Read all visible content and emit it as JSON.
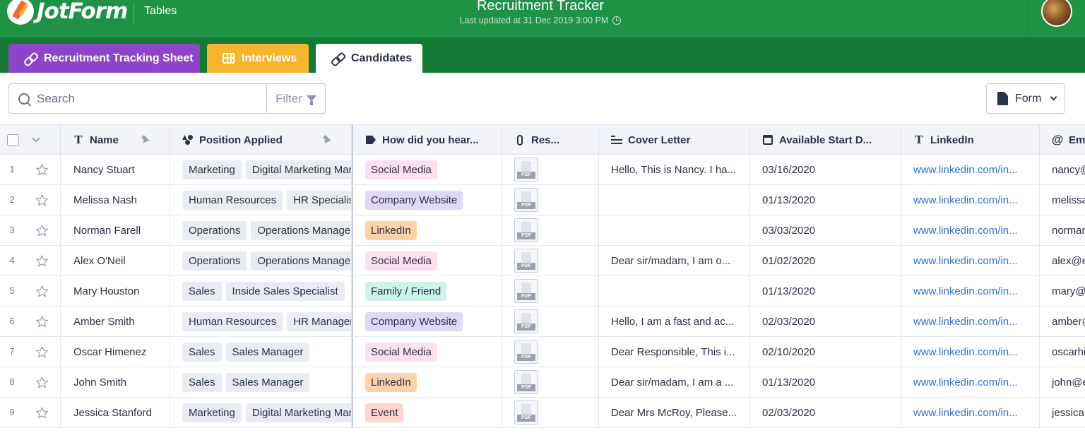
{
  "header": {
    "logo_text": "JotForm",
    "app_name": "Tables",
    "title": "Recruitment Tracker",
    "updated": "Last updated at 31 Dec 2019 3:00 PM",
    "color": "#1e9346"
  },
  "tabs": [
    {
      "label": "Recruitment Tracking Sheet",
      "icon": "link-icon",
      "color": "#8e44c9"
    },
    {
      "label": "Interviews",
      "icon": "grid-icon",
      "color": "#f7b52c"
    },
    {
      "label": "Candidates",
      "icon": "link-icon",
      "color": "#ffffff",
      "active": true
    }
  ],
  "toolbar": {
    "search_placeholder": "Search",
    "filter_label": "Filter",
    "form_label": "Form"
  },
  "columns": {
    "name": "Name",
    "position": "Position Applied",
    "how": "How did you hear...",
    "resume": "Res...",
    "cover": "Cover Letter",
    "start": "Available Start D...",
    "linkedin": "LinkedIn",
    "email": "Em"
  },
  "rows": [
    {
      "num": "1",
      "name": "Nancy Stuart",
      "pos": [
        "Marketing",
        "Digital Marketing Manager"
      ],
      "how": "Social Media",
      "resume": "PDF",
      "cover": "Hello, This is Nancy. I ha...",
      "start": "03/16/2020",
      "linkedin": "www.linkedin.com/in...",
      "email": "nancy@"
    },
    {
      "num": "2",
      "name": "Melissa Nash",
      "pos": [
        "Human Resources",
        "HR Specialist"
      ],
      "how": "Company Website",
      "resume": "PDF",
      "cover": "",
      "start": "01/13/2020",
      "linkedin": "www.linkedin.com/in...",
      "email": "melissa"
    },
    {
      "num": "3",
      "name": "Norman Farell",
      "pos": [
        "Operations",
        "Operations Manager"
      ],
      "how": "LinkedIn",
      "resume": "PDF",
      "cover": "",
      "start": "03/03/2020",
      "linkedin": "www.linkedin.com/in...",
      "email": "norman"
    },
    {
      "num": "4",
      "name": "Alex O'Neil",
      "pos": [
        "Operations",
        "Operations Manager"
      ],
      "how": "Social Media",
      "resume": "PDF",
      "cover": "Dear sir/madam, I am o...",
      "start": "01/02/2020",
      "linkedin": "www.linkedin.com/in...",
      "email": "alex@e"
    },
    {
      "num": "5",
      "name": "Mary Houston",
      "pos": [
        "Sales",
        "Inside Sales Specialist"
      ],
      "how": "Family / Friend",
      "resume": "PDF",
      "cover": "",
      "start": "01/13/2020",
      "linkedin": "www.linkedin.com/in...",
      "email": "mary@"
    },
    {
      "num": "6",
      "name": "Amber Smith",
      "pos": [
        "Human Resources",
        "HR Manager"
      ],
      "how": "Company Website",
      "resume": "PDF",
      "cover": "Hello, I am a fast and ac...",
      "start": "02/03/2020",
      "linkedin": "www.linkedin.com/in...",
      "email": "amber@"
    },
    {
      "num": "7",
      "name": "Oscar Himenez",
      "pos": [
        "Sales",
        "Sales Manager"
      ],
      "how": "Social Media",
      "resume": "PDF",
      "cover": "Dear Responsible, This i...",
      "start": "02/10/2020",
      "linkedin": "www.linkedin.com/in...",
      "email": "oscarhi"
    },
    {
      "num": "8",
      "name": "John Smith",
      "pos": [
        "Sales",
        "Sales Manager"
      ],
      "how": "LinkedIn",
      "resume": "PDF",
      "cover": "Dear sir/madam, I am a ...",
      "start": "01/13/2020",
      "linkedin": "www.linkedin.com/in...",
      "email": "john@e"
    },
    {
      "num": "9",
      "name": "Jessica Stanford",
      "pos": [
        "Marketing",
        "Digital Marketing Manager"
      ],
      "how": "Event",
      "resume": "PDF",
      "cover": "Dear Mrs McRoy, Please...",
      "start": "02/03/2020",
      "linkedin": "www.linkedin.com/in...",
      "email": "jessica"
    }
  ],
  "source_colors": {
    "Social Media": {
      "bg": "#fde0f0",
      "fg": "#2b3245"
    },
    "Company Website": {
      "bg": "#e1d7fb",
      "fg": "#2b3245"
    },
    "LinkedIn": {
      "bg": "#fdd2a7",
      "fg": "#2b3245"
    },
    "Family / Friend": {
      "bg": "#cdf3ec",
      "fg": "#2b3245"
    },
    "Event": {
      "bg": "#fdd6cf",
      "fg": "#2b3245"
    }
  },
  "link_color": "#2f6fe0"
}
